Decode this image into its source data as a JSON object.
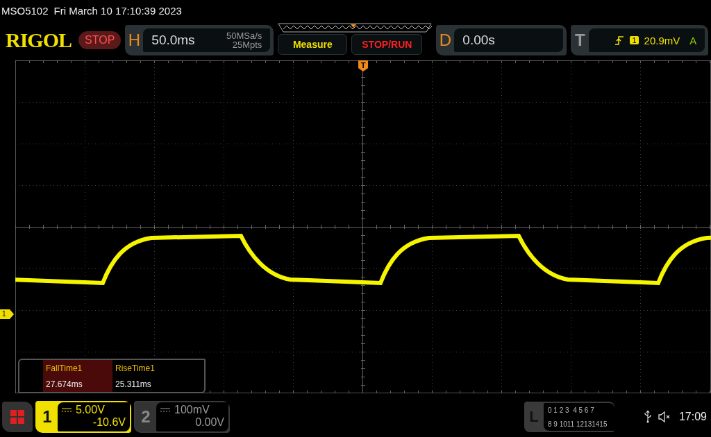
{
  "header": {
    "model": "MSO5102",
    "datetime": "Fri March 10 17:10:39 2023"
  },
  "brand": "RIGOL",
  "run_state": {
    "label": "STOP",
    "kind": "stop"
  },
  "horizontal": {
    "letter": "H",
    "timebase": "50.0ms",
    "sample_rate": "50MSa/s",
    "memory_depth": "25Mpts"
  },
  "buttons": [
    {
      "label": "Measure",
      "kind": "measure"
    },
    {
      "label": "STOP/RUN",
      "kind": "stoprun"
    }
  ],
  "delay": {
    "letter": "D",
    "value": "0.00s"
  },
  "trigger": {
    "letter": "T",
    "source": "1",
    "level": "20.9mV",
    "mode": "A"
  },
  "trigger_marker": "T",
  "channel_marker": "1",
  "measurements": [
    {
      "name": "FallTime1",
      "value": "27.674ms",
      "selected": true
    },
    {
      "name": "RiseTime1",
      "value": "25.311ms",
      "selected": false
    }
  ],
  "channels": [
    {
      "number": "1",
      "scale": "5.00V",
      "offset": "-10.6V",
      "selected": true
    },
    {
      "number": "2",
      "scale": "100mV",
      "offset": "0.00V",
      "selected": false
    }
  ],
  "logic": {
    "letter": "L",
    "row_1": "0 1 2 3  4 5 6 7",
    "row_2": "8 9 1011 12131415"
  },
  "clock": "17:09"
}
